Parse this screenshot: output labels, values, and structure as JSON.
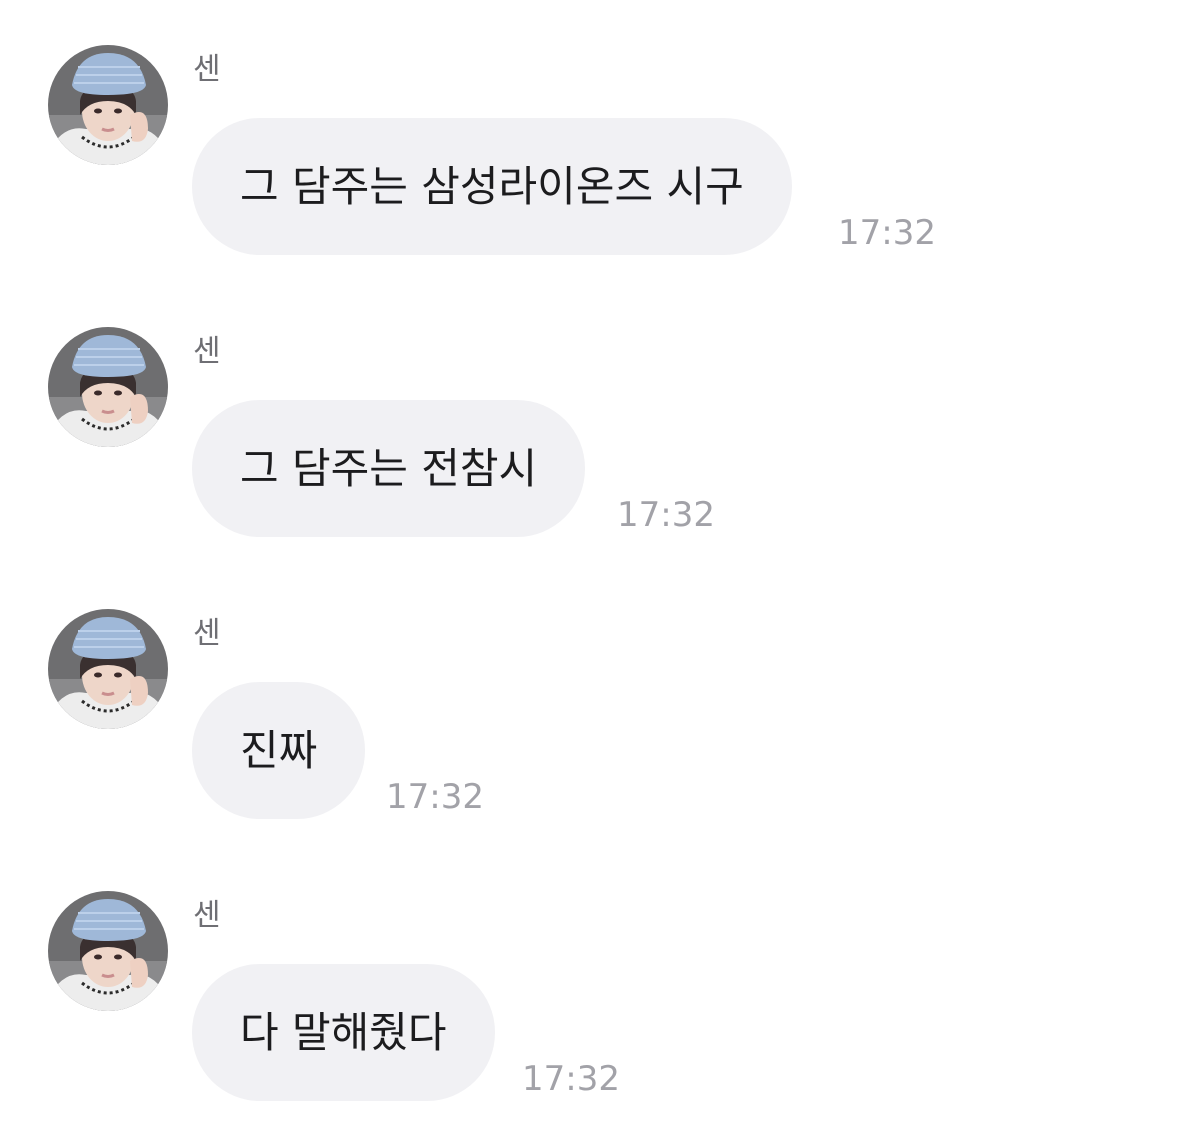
{
  "messages": [
    {
      "sender": "센",
      "text": "그 담주는 삼성라이온즈 시구",
      "time": "17:32"
    },
    {
      "sender": "센",
      "text": "그 담주는 전참시",
      "time": "17:32"
    },
    {
      "sender": "센",
      "text": "진짜",
      "time": "17:32"
    },
    {
      "sender": "센",
      "text": "다 말해줬다",
      "time": "17:32"
    }
  ],
  "colors": {
    "bubble": "#f1f1f4",
    "message_text": "#1c1c1e",
    "sender_text": "#6f6f74",
    "timestamp": "#a2a2a8",
    "avatar_beanie": "#9fb8d8"
  }
}
